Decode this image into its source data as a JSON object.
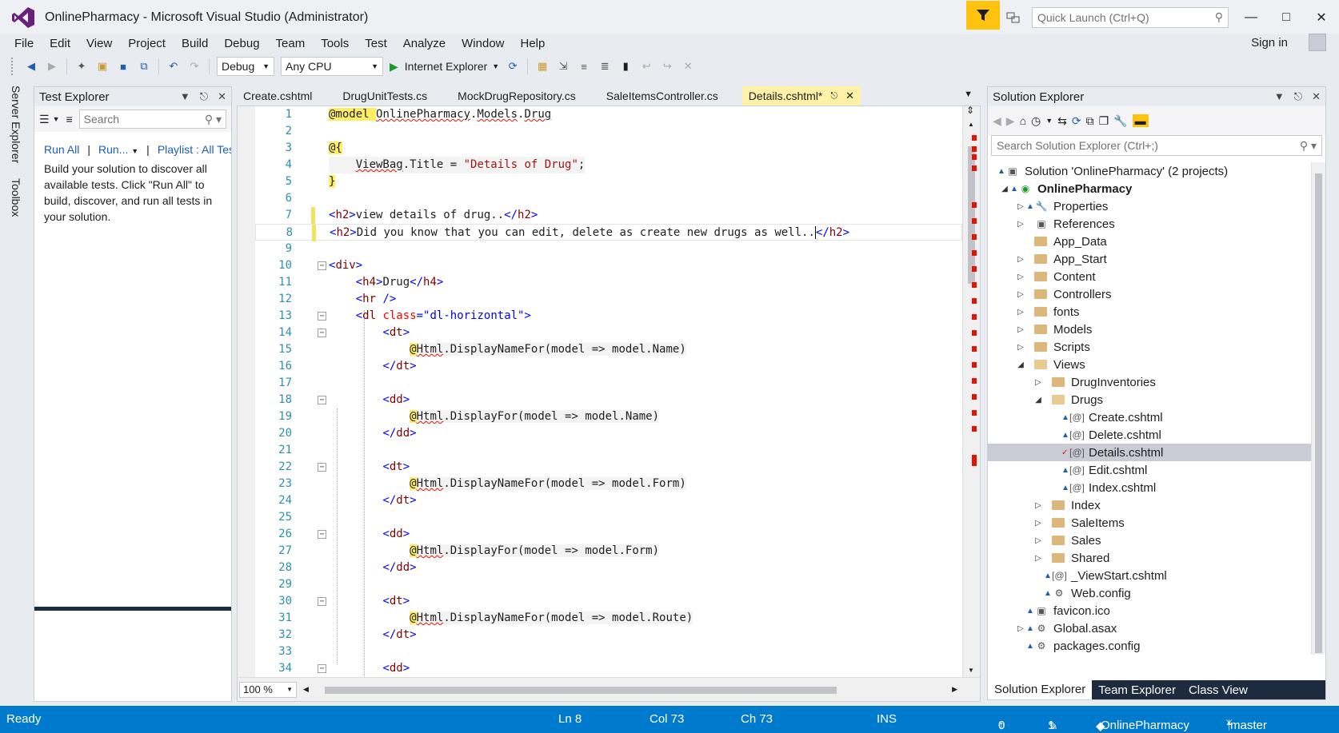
{
  "window": {
    "title": "OnlinePharmacy - Microsoft Visual Studio (Administrator)",
    "quick_launch_placeholder": "Quick Launch (Ctrl+Q)",
    "minimize": "—",
    "maximize": "□",
    "close": "✕"
  },
  "menu": [
    "File",
    "Edit",
    "View",
    "Project",
    "Build",
    "Debug",
    "Team",
    "Tools",
    "Test",
    "Analyze",
    "Window",
    "Help"
  ],
  "signin": "Sign in",
  "toolbar": {
    "config": "Debug",
    "platform": "Any CPU",
    "run_target": "Internet Explorer"
  },
  "side_tabs": [
    "Server Explorer",
    "Toolbox"
  ],
  "test_explorer": {
    "title": "Test Explorer",
    "search_placeholder": "Search",
    "run_all": "Run All",
    "run": "Run...",
    "playlist": "Playlist : All Tests",
    "message": "Build your solution to discover all available tests. Click \"Run All\" to build, discover, and run all tests in your solution."
  },
  "editor": {
    "tabs": [
      "Create.cshtml",
      "DrugUnitTests.cs",
      "MockDrugRepository.cs",
      "SaleItemsController.cs"
    ],
    "active_tab": "Details.cshtml*",
    "zoom": "100 %",
    "line_numbers": [
      "1",
      "2",
      "3",
      "4",
      "5",
      "6",
      "7",
      "8",
      "9",
      "10",
      "11",
      "12",
      "13",
      "14",
      "15",
      "16",
      "17",
      "18",
      "19",
      "20",
      "21",
      "22",
      "23",
      "24",
      "25",
      "26",
      "27",
      "28",
      "29",
      "30",
      "31",
      "32",
      "33",
      "34"
    ]
  },
  "solution_explorer": {
    "title": "Solution Explorer",
    "search_placeholder": "Search Solution Explorer (Ctrl+;)",
    "nodes": [
      "Solution 'OnlinePharmacy' (2 projects)",
      "OnlinePharmacy",
      "Properties",
      "References",
      "App_Data",
      "App_Start",
      "Content",
      "Controllers",
      "fonts",
      "Models",
      "Scripts",
      "Views",
      "DrugInventories",
      "Drugs",
      "Create.cshtml",
      "Delete.cshtml",
      "Details.cshtml",
      "Edit.cshtml",
      "Index.cshtml",
      "Index",
      "SaleItems",
      "Sales",
      "Shared",
      "_ViewStart.cshtml",
      "Web.config",
      "favicon.ico",
      "Global.asax",
      "packages.config"
    ],
    "bottom_tabs": [
      "Solution Explorer",
      "Team Explorer",
      "Class View"
    ]
  },
  "status": {
    "ready": "Ready",
    "ln": "Ln 8",
    "col": "Col 73",
    "ch": "Ch 73",
    "ins": "INS",
    "up": "0",
    "edits": "1",
    "repo": "OnlinePharmacy",
    "branch": "master"
  },
  "colors": {
    "accent": "#007acc",
    "active_tab": "#fff1a8",
    "razor_highlight": "#ffee62",
    "error_mark": "#e51400"
  }
}
